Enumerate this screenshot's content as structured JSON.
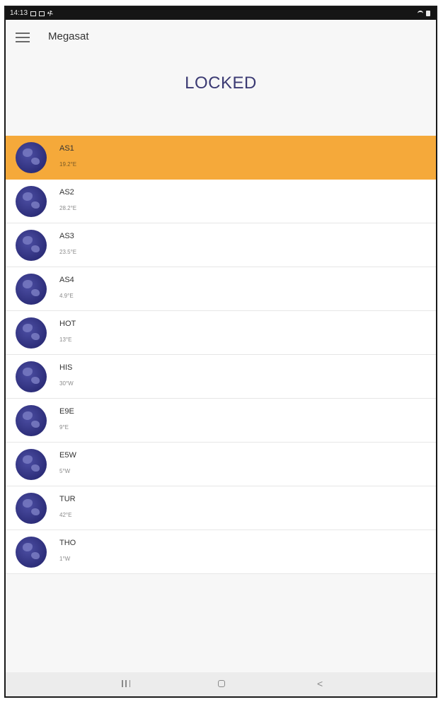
{
  "status_bar": {
    "time": "14:13"
  },
  "app_bar": {
    "title": "Megasat"
  },
  "header": {
    "status": "LOCKED"
  },
  "satellites": [
    {
      "name": "AS1",
      "position": "19.2°E",
      "selected": true
    },
    {
      "name": "AS2",
      "position": "28.2°E",
      "selected": false
    },
    {
      "name": "AS3",
      "position": "23.5°E",
      "selected": false
    },
    {
      "name": "AS4",
      "position": "4.9°E",
      "selected": false
    },
    {
      "name": "HOT",
      "position": "13°E",
      "selected": false
    },
    {
      "name": "HIS",
      "position": "30°W",
      "selected": false
    },
    {
      "name": "E9E",
      "position": "9°E",
      "selected": false
    },
    {
      "name": "E5W",
      "position": "5°W",
      "selected": false
    },
    {
      "name": "TUR",
      "position": "42°E",
      "selected": false
    },
    {
      "name": "THO",
      "position": "1°W",
      "selected": false
    }
  ],
  "colors": {
    "selected_row": "#f5a93a",
    "status_title": "#3b3a73",
    "avatar": "#2d2e7a"
  },
  "icons": {
    "menu": "hamburger-icon",
    "avatar": "globe-icon",
    "nav_recents": "recents-icon",
    "nav_home": "home-icon",
    "nav_back": "back-icon"
  },
  "nav_bar": {
    "back_glyph": "<"
  }
}
